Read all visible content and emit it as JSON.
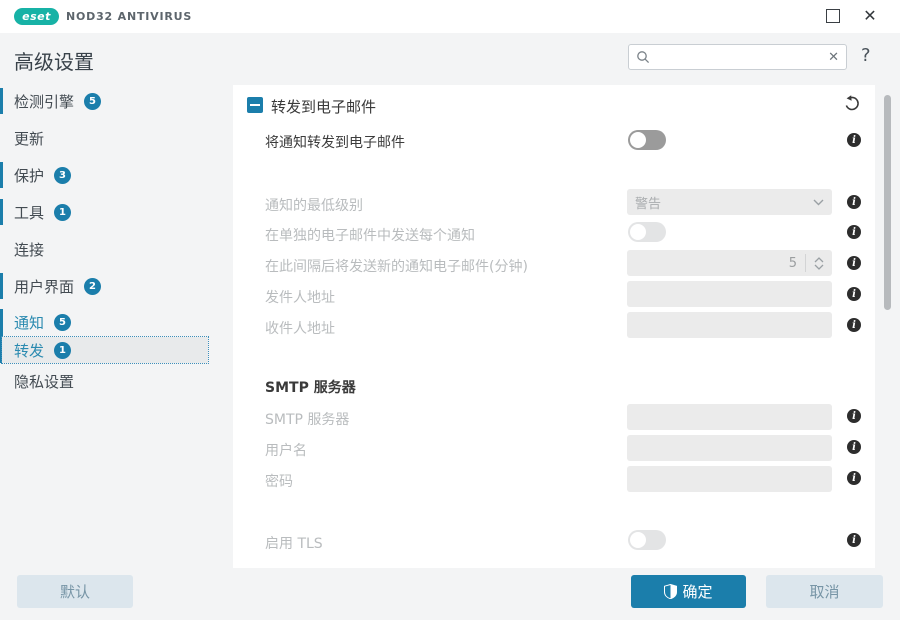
{
  "titlebar": {
    "logo_text": "eset",
    "product_name": "NOD32 ANTIVIRUS",
    "close_icon": "✕"
  },
  "header": {
    "title": "高级设置",
    "search": {
      "value": "",
      "placeholder": ""
    },
    "clear_icon": "✕",
    "help_icon": "?"
  },
  "sidebar": {
    "items": [
      {
        "label": "检测引擎",
        "badge": "5"
      },
      {
        "label": "更新",
        "badge": ""
      },
      {
        "label": "保护",
        "badge": "3"
      },
      {
        "label": "工具",
        "badge": "1"
      },
      {
        "label": "连接",
        "badge": ""
      },
      {
        "label": "用户界面",
        "badge": "2"
      },
      {
        "label": "通知",
        "badge": "5"
      },
      {
        "label": "转发",
        "badge": "1"
      },
      {
        "label": "隐私设置",
        "badge": ""
      }
    ]
  },
  "content": {
    "section_title": "转发到电子邮件",
    "rows": {
      "forward_toggle": {
        "label": "将通知转发到电子邮件",
        "state": "off"
      },
      "min_level": {
        "label": "通知的最低级别",
        "value": "警告"
      },
      "separate_email": {
        "label": "在单独的电子邮件中发送每个通知",
        "state": "off"
      },
      "interval": {
        "label": "在此间隔后将发送新的通知电子邮件(分钟)",
        "value": "5"
      },
      "sender": {
        "label": "发件人地址",
        "value": ""
      },
      "recipient": {
        "label": "收件人地址",
        "value": ""
      }
    },
    "smtp": {
      "title": "SMTP 服务器",
      "server": {
        "label": "SMTP 服务器",
        "value": ""
      },
      "username": {
        "label": "用户名",
        "value": ""
      },
      "password": {
        "label": "密码",
        "value": ""
      },
      "tls": {
        "label": "启用 TLS",
        "state": "off"
      }
    }
  },
  "footer": {
    "default_label": "默认",
    "ok_label": "确定",
    "cancel_label": "取消"
  },
  "colors": {
    "accent_blue": "#1b7eab",
    "brand_teal": "#17b2a6",
    "selected_text": "#2a8ab0",
    "window_bg": "#f3f4f5",
    "panel_bg": "#ffffff",
    "input_bg": "#ebebeb",
    "disabled_text": "#b9bcbe"
  }
}
